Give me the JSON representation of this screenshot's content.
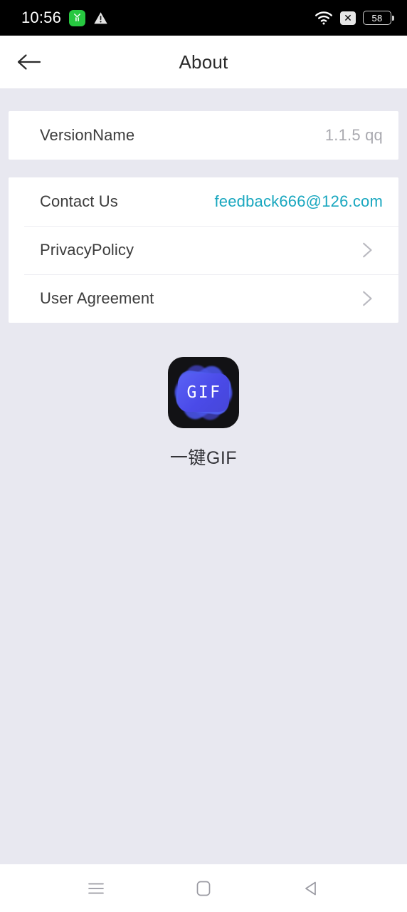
{
  "status_bar": {
    "clock": "10:56",
    "battery_level": "58",
    "icons": {
      "app_badge": "green-app-icon",
      "warning": "warning-triangle-icon",
      "wifi": "wifi-icon",
      "no_sim": "no-signal-icon",
      "battery": "battery-icon"
    },
    "no_sim_glyph": "✕",
    "background_color": "#000000"
  },
  "app_bar": {
    "title": "About",
    "back_icon": "arrow-left-icon"
  },
  "settings": {
    "group_one": [
      {
        "label": "VersionName",
        "value": "1.1.5  qq",
        "type": "value",
        "name": "version-name-row"
      }
    ],
    "group_two": [
      {
        "label": "Contact Us",
        "value": "feedback666@126.com",
        "type": "link",
        "name": "contact-us-row"
      },
      {
        "label": "PrivacyPolicy",
        "value": "",
        "type": "chevron",
        "name": "privacy-policy-row"
      },
      {
        "label": "User Agreement",
        "value": "",
        "type": "chevron",
        "name": "user-agreement-row"
      }
    ]
  },
  "app_identity": {
    "logo_text": "GIF",
    "app_name": "一键GIF"
  },
  "nav_bar": {
    "recents_icon": "menu-icon",
    "home_icon": "home-square-icon",
    "back_icon": "back-triangle-icon"
  },
  "colors": {
    "page_background": "#e8e8f0",
    "card_background": "#ffffff",
    "link": "#19a7bf",
    "value_muted": "#a9a9af",
    "label": "#3c3c3c",
    "logo_blue": "#4b4fe0",
    "logo_black": "#121215",
    "status_green": "#27c840"
  }
}
